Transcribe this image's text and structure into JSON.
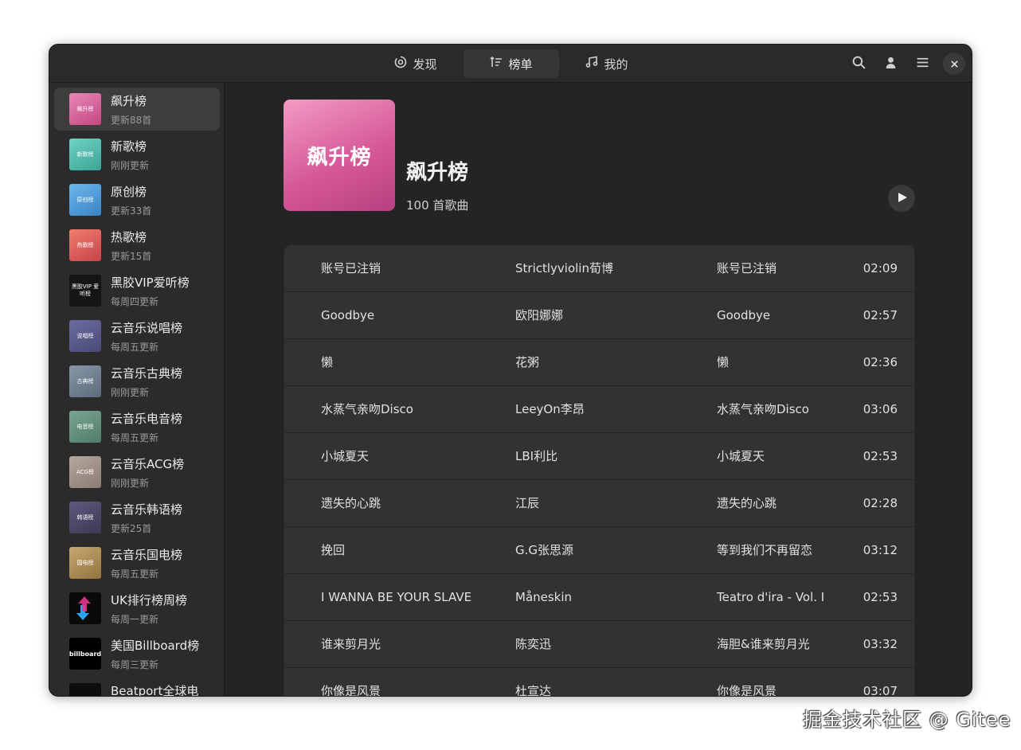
{
  "header": {
    "tabs": [
      {
        "label": "发现",
        "icon": "discover-icon"
      },
      {
        "label": "榜单",
        "icon": "chart-list-icon"
      },
      {
        "label": "我的",
        "icon": "music-note-icon"
      }
    ],
    "active_tab": "榜单",
    "icons": [
      "search-icon",
      "user-icon",
      "menu-icon",
      "close-icon"
    ]
  },
  "sidebar": {
    "items": [
      {
        "name": "飙升榜",
        "sub": "更新88首",
        "thumb": "飙升榜",
        "color": "#d25d98"
      },
      {
        "name": "新歌榜",
        "sub": "刚刚更新",
        "thumb": "新歌榜",
        "color": "#55b9ad"
      },
      {
        "name": "原创榜",
        "sub": "更新33首",
        "thumb": "原创榜",
        "color": "#4f9ddc"
      },
      {
        "name": "热歌榜",
        "sub": "更新15首",
        "thumb": "热歌榜",
        "color": "#dd5f5f"
      },
      {
        "name": "黑胶VIP爱听榜",
        "sub": "每周四更新",
        "thumb": "黑胶VIP 爱听榜",
        "color": "#1a1a1a"
      },
      {
        "name": "云音乐说唱榜",
        "sub": "每周五更新",
        "thumb": "说唱榜",
        "color": "#5b5b8c"
      },
      {
        "name": "云音乐古典榜",
        "sub": "刚刚更新",
        "thumb": "古典榜",
        "color": "#6b7b8e"
      },
      {
        "name": "云音乐电音榜",
        "sub": "每周五更新",
        "thumb": "电音榜",
        "color": "#5f8f7b"
      },
      {
        "name": "云音乐ACG榜",
        "sub": "刚刚更新",
        "thumb": "ACG榜",
        "color": "#9d8e85"
      },
      {
        "name": "云音乐韩语榜",
        "sub": "更新25首",
        "thumb": "韩语榜",
        "color": "#4f4a68"
      },
      {
        "name": "云音乐国电榜",
        "sub": "每周五更新",
        "thumb": "国电榜",
        "color": "#b08f5c"
      },
      {
        "name": "UK排行榜周榜",
        "sub": "每周一更新",
        "thumb": "",
        "color": "#0a0a0a"
      },
      {
        "name": "美国Billboard榜",
        "sub": "每周三更新",
        "thumb": "billboard",
        "color": "#000000"
      },
      {
        "name": "Beatport全球电",
        "sub": "",
        "thumb": "",
        "color": "#0d0d0d"
      }
    ]
  },
  "playlist": {
    "cover_text": "飙升榜",
    "title": "飙升榜",
    "count": "100 首歌曲"
  },
  "songs": [
    {
      "title": "账号已注销",
      "artist": "Strictlyviolin荀博",
      "album": "账号已注销",
      "duration": "02:09"
    },
    {
      "title": "Goodbye",
      "artist": "欧阳娜娜",
      "album": "Goodbye",
      "duration": "02:57"
    },
    {
      "title": "懒",
      "artist": "花粥",
      "album": "懒",
      "duration": "02:36"
    },
    {
      "title": "水蒸气亲吻Disco",
      "artist": "LeeyOn李昂",
      "album": "水蒸气亲吻Disco",
      "duration": "03:06"
    },
    {
      "title": "小城夏天",
      "artist": "LBI利比",
      "album": "小城夏天",
      "duration": "02:53"
    },
    {
      "title": "遗失的心跳",
      "artist": "江辰",
      "album": "遗失的心跳",
      "duration": "02:28"
    },
    {
      "title": "挽回",
      "artist": "G.G张思源",
      "album": "等到我们不再留恋",
      "duration": "03:12"
    },
    {
      "title": "I WANNA BE YOUR SLAVE",
      "artist": "Måneskin",
      "album": "Teatro d'ira - Vol. I",
      "duration": "02:53"
    },
    {
      "title": "谁来剪月光",
      "artist": "陈奕迅",
      "album": "海胆&谁来剪月光",
      "duration": "03:32"
    },
    {
      "title": "你像是风景",
      "artist": "杜宣达",
      "album": "你像是风景",
      "duration": "03:07"
    }
  ],
  "watermark": "掘金技术社区 @ Gitee"
}
